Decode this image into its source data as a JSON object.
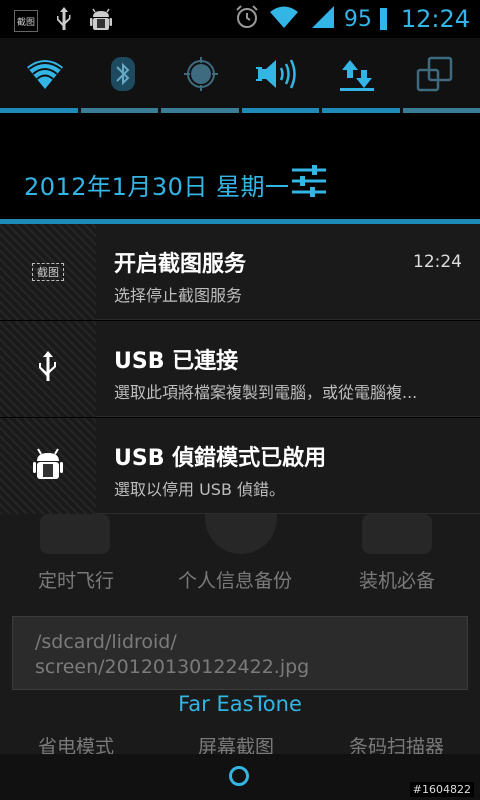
{
  "status_bar": {
    "screenshot_icon_label": "截图",
    "battery_level": "95",
    "time": "12:24",
    "icons": [
      "screenshot-icon",
      "usb-icon",
      "android-debug-icon",
      "alarm-icon",
      "wifi-icon",
      "signal-icon",
      "battery-icon"
    ]
  },
  "toggles": [
    {
      "icon": "wifi-icon",
      "state": "on"
    },
    {
      "icon": "bluetooth-icon",
      "state": "off"
    },
    {
      "icon": "gps-icon",
      "state": "off"
    },
    {
      "icon": "sound-icon",
      "state": "on"
    },
    {
      "icon": "data-sync-icon",
      "state": "on"
    },
    {
      "icon": "auto-rotate-icon",
      "state": "off"
    }
  ],
  "date_bar": {
    "date": "2012年1月30日 星期一",
    "settings_icon": "settings-sliders-icon"
  },
  "notifications": [
    {
      "icon": "screenshot-icon",
      "icon_label": "截图",
      "title": "开启截图服务",
      "subtitle": "选择停止截图服务",
      "time": "12:24"
    },
    {
      "icon": "usb-icon",
      "title": "USB 已連接",
      "subtitle": "選取此項將檔案複製到電腦，或從電腦複...",
      "time": ""
    },
    {
      "icon": "android-debug-icon",
      "title": "USB 偵錯模式已啟用",
      "subtitle": "選取以停用 USB 偵錯。",
      "time": ""
    }
  ],
  "launcher": {
    "row1": [
      "定时飞行",
      "个人信息备份",
      "装机必备"
    ],
    "row2": [
      "省电模式",
      "屏幕截图",
      "条码扫描器"
    ]
  },
  "toast": {
    "line1": "/sdcard/lidroid/",
    "line2": "screen/20120130122422.jpg"
  },
  "carrier": "Far EasTone",
  "watermark": "#1604822",
  "colors": {
    "accent": "#33b5e5",
    "bar": "#1e8ab8"
  }
}
